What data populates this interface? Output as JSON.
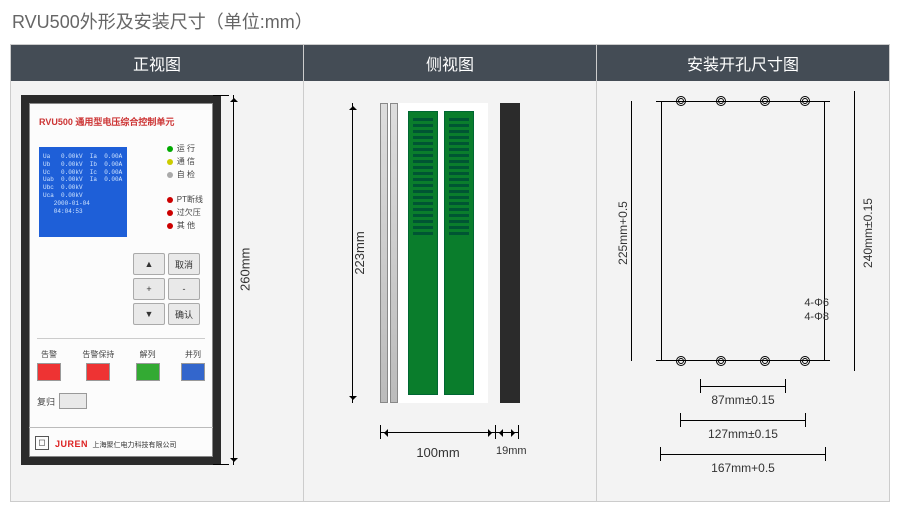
{
  "page_title": "RVU500外形及安装尺寸（单位:mm）",
  "headers": {
    "front": "正视图",
    "side": "侧视图",
    "cutout": "安装开孔尺寸图"
  },
  "front": {
    "product_title": "RVU500 通用型电压综合控制单元",
    "lcd_lines": [
      "Ua   0.00kV  Ia  0.00A",
      "Ub   0.00kV  Ib  0.00A",
      "Uc   0.00kV  Ic  0.00A",
      "Uab  0.00kV  Ia  0.00A",
      "Ubc  0.00kV",
      "Uca  0.00kV",
      "   2000-01-04",
      "   04:04:53"
    ],
    "leds_top": [
      {
        "c": "g",
        "t": "运 行"
      },
      {
        "c": "y",
        "t": "通 信"
      },
      {
        "c": "grey",
        "t": "自 检"
      }
    ],
    "leds_bottom": [
      {
        "c": "r",
        "t": "PT断线"
      },
      {
        "c": "r",
        "t": "过欠压"
      },
      {
        "c": "r",
        "t": "其 他"
      }
    ],
    "keys": [
      "▲",
      "取消",
      "+",
      "-",
      "▼",
      "确认"
    ],
    "btn_cols": [
      {
        "label": "告警",
        "class": "sq-red"
      },
      {
        "label": "告警保持",
        "class": "sq-red"
      },
      {
        "label": "解列",
        "class": "sq-green"
      },
      {
        "label": "并列",
        "class": "sq-blue"
      }
    ],
    "reset_label": "复归",
    "brand": "JUREN",
    "brand_sub": "上海聚仁电力科技有限公司",
    "height_label": "260mm"
  },
  "side": {
    "depth_label": "100mm",
    "bezel_label": "19mm",
    "height_label": "223mm"
  },
  "cutout": {
    "v_inner": "225mm+0.5",
    "v_outer": "240mm±0.15",
    "phi_small": "4-Φ6",
    "phi_large": "4-Φ8",
    "h_87": "87mm±0.15",
    "h_127": "127mm±0.15",
    "h_167": "167mm+0.5"
  }
}
